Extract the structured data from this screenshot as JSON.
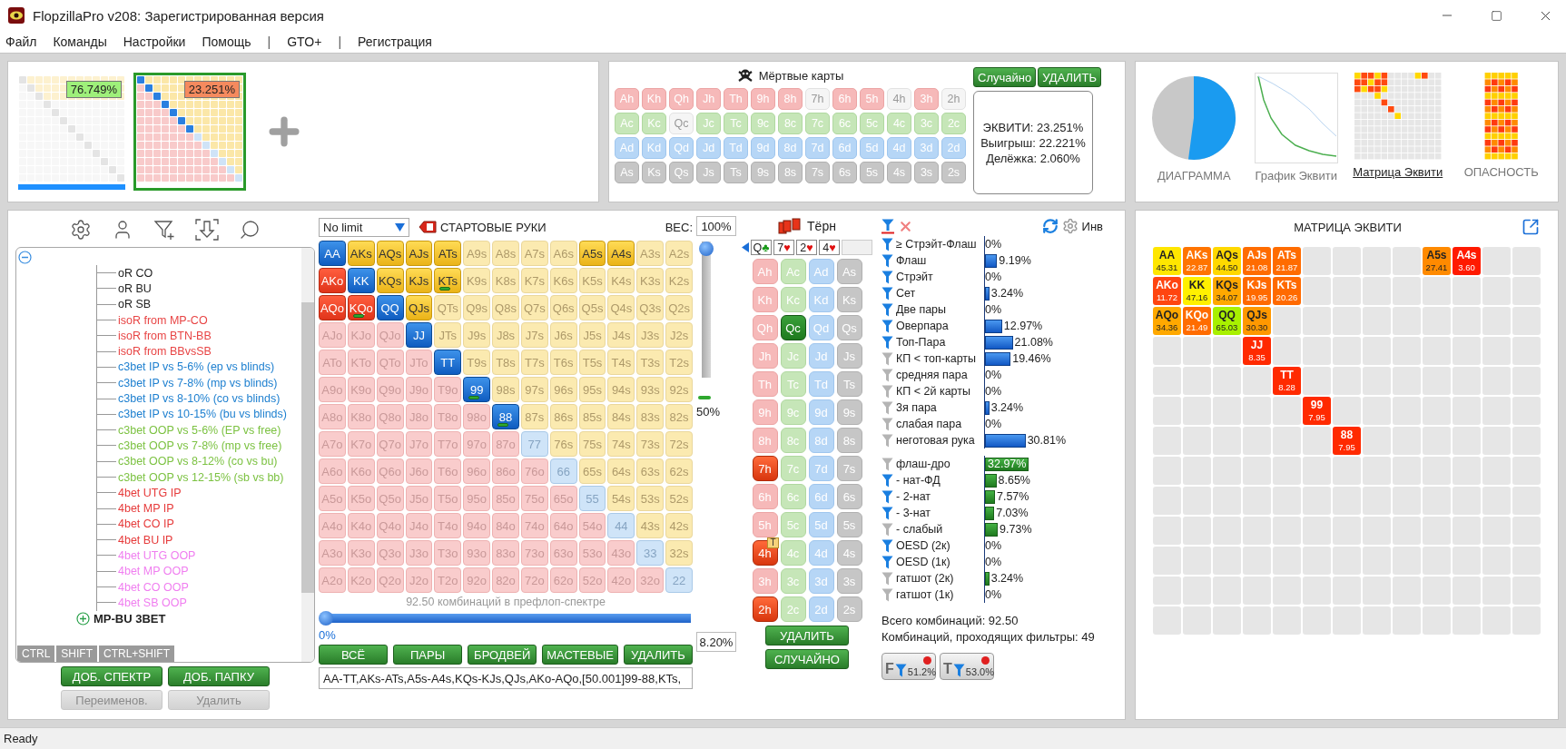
{
  "window": {
    "title": "FlopzillaPro v208: Зарегистрированная версия"
  },
  "menu": [
    {
      "label": "Файл",
      "kind": "item"
    },
    {
      "label": "Команды",
      "kind": "item"
    },
    {
      "label": "Настройки",
      "kind": "item"
    },
    {
      "label": "Помощь",
      "kind": "item"
    },
    {
      "label": "|",
      "kind": "separator"
    },
    {
      "label": "GTO+",
      "kind": "item"
    },
    {
      "label": "|",
      "kind": "separator"
    },
    {
      "label": "Регистрация",
      "kind": "item"
    }
  ],
  "ranges": [
    {
      "percent": "76.749%",
      "selected": false,
      "color": "#9ef07a"
    },
    {
      "percent": "23.251%",
      "selected": true,
      "color": "#f58a5e"
    }
  ],
  "dead_cards": {
    "title": "Мёртвые карты",
    "rows": [
      {
        "cards": [
          "Ah",
          "Kh",
          "Qh",
          "Jh",
          "Th",
          "9h",
          "8h",
          "7h",
          "6h",
          "5h",
          "4h",
          "3h",
          "2h"
        ],
        "disabled": [
          false,
          false,
          false,
          false,
          false,
          false,
          false,
          true,
          false,
          false,
          true,
          false,
          true
        ]
      },
      {
        "cards": [
          "Ac",
          "Kc",
          "Qc",
          "Jc",
          "Tc",
          "9c",
          "8c",
          "7c",
          "6c",
          "5c",
          "4c",
          "3c",
          "2c"
        ],
        "disabled": [
          false,
          false,
          true,
          false,
          false,
          false,
          false,
          false,
          false,
          false,
          false,
          false,
          false
        ]
      },
      {
        "cards": [
          "Ad",
          "Kd",
          "Qd",
          "Jd",
          "Td",
          "9d",
          "8d",
          "7d",
          "6d",
          "5d",
          "4d",
          "3d",
          "2d"
        ],
        "disabled": [
          false,
          false,
          false,
          false,
          false,
          false,
          false,
          false,
          false,
          false,
          false,
          false,
          false
        ]
      },
      {
        "cards": [
          "As",
          "Ks",
          "Qs",
          "Js",
          "Ts",
          "9s",
          "8s",
          "7s",
          "6s",
          "5s",
          "4s",
          "3s",
          "2s"
        ],
        "disabled": [
          false,
          false,
          false,
          false,
          false,
          false,
          false,
          false,
          false,
          false,
          false,
          false,
          false
        ]
      }
    ],
    "buttons": [
      "Случайно",
      "УДАЛИТЬ"
    ],
    "equity": [
      "ЭКВИТИ: 23.251%",
      "Выигрыш: 22.221%",
      "Делёжка: 2.060%"
    ]
  },
  "views": [
    {
      "label": "ДИАГРАММА",
      "selected": false
    },
    {
      "label": "График Эквити",
      "selected": false
    },
    {
      "label": "Матрица Эквити",
      "selected": true
    },
    {
      "label": "ОПАСНОСТЬ",
      "selected": false
    }
  ],
  "tree": {
    "nodes": [
      {
        "expanded": true,
        "children": [
          {
            "label": "oR CO",
            "color": "#222222"
          },
          {
            "label": "oR BU",
            "color": "#222222"
          },
          {
            "label": "oR SB",
            "color": "#222222"
          },
          {
            "label": "isoR from MP-CO",
            "color": "#e84545"
          },
          {
            "label": "isoR from BTN-BB",
            "color": "#e84545"
          },
          {
            "label": "isoR from BBvsSB",
            "color": "#e84545"
          },
          {
            "label": "c3bet IP vs 5-6% (ep vs blinds)",
            "color": "#1f80d0"
          },
          {
            "label": "c3bet IP vs 7-8% (mp vs blinds)",
            "color": "#1f80d0"
          },
          {
            "label": "c3bet IP vs 8-10% (co vs blinds)",
            "color": "#1f80d0"
          },
          {
            "label": "c3bet IP vs 10-15% (bu vs blinds)",
            "color": "#1f80d0"
          },
          {
            "label": "c3bet OOP vs 5-6% (EP vs free)",
            "color": "#7cc242"
          },
          {
            "label": "c3bet OOP vs 7-8% (mp vs free)",
            "color": "#7cc242"
          },
          {
            "label": "c3bet OOP vs 8-12% (co vs bu)",
            "color": "#7cc242"
          },
          {
            "label": "c3bet OOP vs 12-15% (sb vs bb)",
            "color": "#7cc242"
          },
          {
            "label": "4bet UTG IP",
            "color": "#e63a3a"
          },
          {
            "label": "4bet MP IP",
            "color": "#e63a3a"
          },
          {
            "label": "4bet CO IP",
            "color": "#e63a3a"
          },
          {
            "label": "4bet BU IP",
            "color": "#e63a3a"
          },
          {
            "label": "4bet UTG OOP",
            "color": "#f07ef0"
          },
          {
            "label": "4bet MP OOP",
            "color": "#f07ef0"
          },
          {
            "label": "4bet CO OOP",
            "color": "#f07ef0"
          },
          {
            "label": "4bet SB OOP",
            "color": "#f07ef0"
          }
        ]
      },
      {
        "label": "MP-BU 3BET",
        "expanded": false
      }
    ],
    "tabs": [
      "CTRL",
      "SHIFT",
      "CTRL+SHIFT"
    ],
    "buttons": [
      {
        "label": "ДОБ. СПЕКТР",
        "disabled": false
      },
      {
        "label": "ДОБ. ПАПКУ",
        "disabled": false
      },
      {
        "label": "Переименов.",
        "disabled": true
      },
      {
        "label": "Удалить",
        "disabled": true
      }
    ]
  },
  "hands": {
    "game": "No limit",
    "title": "СТАРТОВЫЕ РУКИ",
    "weight_label": "ВЕС:",
    "weight": "100%",
    "rows": [
      {
        "labels": [
          "AA",
          "AKs",
          "AQs",
          "AJs",
          "ATs",
          "A9s",
          "A8s",
          "A7s",
          "A6s",
          "A5s",
          "A4s",
          "A3s",
          "A2s"
        ],
        "selected": [
          true,
          true,
          true,
          true,
          true,
          false,
          false,
          false,
          false,
          true,
          true,
          false,
          false
        ],
        "marked": [
          false,
          false,
          false,
          false,
          false,
          false,
          false,
          false,
          false,
          false,
          false,
          false,
          false
        ]
      },
      {
        "labels": [
          "AKo",
          "KK",
          "KQs",
          "KJs",
          "KTs",
          "K9s",
          "K8s",
          "K7s",
          "K6s",
          "K5s",
          "K4s",
          "K3s",
          "K2s"
        ],
        "selected": [
          true,
          true,
          true,
          true,
          true,
          false,
          false,
          false,
          false,
          false,
          false,
          false,
          false
        ],
        "marked": [
          false,
          false,
          false,
          false,
          true,
          false,
          false,
          false,
          false,
          false,
          false,
          false,
          false
        ]
      },
      {
        "labels": [
          "AQo",
          "KQo",
          "QQ",
          "QJs",
          "QTs",
          "Q9s",
          "Q8s",
          "Q7s",
          "Q6s",
          "Q5s",
          "Q4s",
          "Q3s",
          "Q2s"
        ],
        "selected": [
          true,
          true,
          true,
          true,
          false,
          false,
          false,
          false,
          false,
          false,
          false,
          false,
          false
        ],
        "marked": [
          false,
          true,
          false,
          false,
          false,
          false,
          false,
          false,
          false,
          false,
          false,
          false,
          false
        ]
      },
      {
        "labels": [
          "AJo",
          "KJo",
          "QJo",
          "JJ",
          "JTs",
          "J9s",
          "J8s",
          "J7s",
          "J6s",
          "J5s",
          "J4s",
          "J3s",
          "J2s"
        ],
        "selected": [
          false,
          false,
          false,
          true,
          false,
          false,
          false,
          false,
          false,
          false,
          false,
          false,
          false
        ],
        "marked": [
          false,
          false,
          false,
          false,
          false,
          false,
          false,
          false,
          false,
          false,
          false,
          false,
          false
        ]
      },
      {
        "labels": [
          "ATo",
          "KTo",
          "QTo",
          "JTo",
          "TT",
          "T9s",
          "T8s",
          "T7s",
          "T6s",
          "T5s",
          "T4s",
          "T3s",
          "T2s"
        ],
        "selected": [
          false,
          false,
          false,
          false,
          true,
          false,
          false,
          false,
          false,
          false,
          false,
          false,
          false
        ],
        "marked": [
          false,
          false,
          false,
          false,
          false,
          false,
          false,
          false,
          false,
          false,
          false,
          false,
          false
        ]
      },
      {
        "labels": [
          "A9o",
          "K9o",
          "Q9o",
          "J9o",
          "T9o",
          "99",
          "98s",
          "97s",
          "96s",
          "95s",
          "94s",
          "93s",
          "92s"
        ],
        "selected": [
          false,
          false,
          false,
          false,
          false,
          true,
          false,
          false,
          false,
          false,
          false,
          false,
          false
        ],
        "marked": [
          false,
          false,
          false,
          false,
          false,
          true,
          false,
          false,
          false,
          false,
          false,
          false,
          false
        ]
      },
      {
        "labels": [
          "A8o",
          "K8o",
          "Q8o",
          "J8o",
          "T8o",
          "98o",
          "88",
          "87s",
          "86s",
          "85s",
          "84s",
          "83s",
          "82s"
        ],
        "selected": [
          false,
          false,
          false,
          false,
          false,
          false,
          true,
          false,
          false,
          false,
          false,
          false,
          false
        ],
        "marked": [
          false,
          false,
          false,
          false,
          false,
          false,
          true,
          false,
          false,
          false,
          false,
          false,
          false
        ]
      },
      {
        "labels": [
          "A7o",
          "K7o",
          "Q7o",
          "J7o",
          "T7o",
          "97o",
          "87o",
          "77",
          "76s",
          "75s",
          "74s",
          "73s",
          "72s"
        ],
        "selected": [
          false,
          false,
          false,
          false,
          false,
          false,
          false,
          false,
          false,
          false,
          false,
          false,
          false
        ],
        "marked": [
          false,
          false,
          false,
          false,
          false,
          false,
          false,
          false,
          false,
          false,
          false,
          false,
          false
        ]
      },
      {
        "labels": [
          "A6o",
          "K6o",
          "Q6o",
          "J6o",
          "T6o",
          "96o",
          "86o",
          "76o",
          "66",
          "65s",
          "64s",
          "63s",
          "62s"
        ],
        "selected": [
          false,
          false,
          false,
          false,
          false,
          false,
          false,
          false,
          false,
          false,
          false,
          false,
          false
        ],
        "marked": [
          false,
          false,
          false,
          false,
          false,
          false,
          false,
          false,
          false,
          false,
          false,
          false,
          false
        ]
      },
      {
        "labels": [
          "A5o",
          "K5o",
          "Q5o",
          "J5o",
          "T5o",
          "95o",
          "85o",
          "75o",
          "65o",
          "55",
          "54s",
          "53s",
          "52s"
        ],
        "selected": [
          false,
          false,
          false,
          false,
          false,
          false,
          false,
          false,
          false,
          false,
          false,
          false,
          false
        ],
        "marked": [
          false,
          false,
          false,
          false,
          false,
          false,
          false,
          false,
          false,
          false,
          false,
          false,
          false
        ]
      },
      {
        "labels": [
          "A4o",
          "K4o",
          "Q4o",
          "J4o",
          "T4o",
          "94o",
          "84o",
          "74o",
          "64o",
          "54o",
          "44",
          "43s",
          "42s"
        ],
        "selected": [
          false,
          false,
          false,
          false,
          false,
          false,
          false,
          false,
          false,
          false,
          false,
          false,
          false
        ],
        "marked": [
          false,
          false,
          false,
          false,
          false,
          false,
          false,
          false,
          false,
          false,
          false,
          false,
          false
        ]
      },
      {
        "labels": [
          "A3o",
          "K3o",
          "Q3o",
          "J3o",
          "T3o",
          "93o",
          "83o",
          "73o",
          "63o",
          "53o",
          "43o",
          "33",
          "32s"
        ],
        "selected": [
          false,
          false,
          false,
          false,
          false,
          false,
          false,
          false,
          false,
          false,
          false,
          false,
          false
        ],
        "marked": [
          false,
          false,
          false,
          false,
          false,
          false,
          false,
          false,
          false,
          false,
          false,
          false,
          false
        ]
      },
      {
        "labels": [
          "A2o",
          "K2o",
          "Q2o",
          "J2o",
          "T2o",
          "92o",
          "82o",
          "72o",
          "62o",
          "52o",
          "42o",
          "32o",
          "22"
        ],
        "selected": [
          false,
          false,
          false,
          false,
          false,
          false,
          false,
          false,
          false,
          false,
          false,
          false,
          false
        ],
        "marked": [
          false,
          false,
          false,
          false,
          false,
          false,
          false,
          false,
          false,
          false,
          false,
          false,
          false
        ]
      }
    ],
    "weight_slider": {
      "level": 1,
      "reading": "50%"
    },
    "percent_field": "8.20%",
    "combos_caption": "92.50 комбинаций в префлоп-спектре",
    "preflop_slider": {
      "level": 0,
      "reading": "0%"
    },
    "buttons": [
      "ВСЁ",
      "ПАРЫ",
      "БРОДВЕЙ",
      "МАСТЕВЫЕ",
      "УДАЛИТЬ"
    ],
    "range_text": "AA-TT,AKs-ATs,A5s-A4s,KQs-KJs,QJs,AKo-AQo,[50.001]99-88,KTs,"
  },
  "turn": {
    "title": "Тёрн",
    "board": [
      {
        "rank": "Q",
        "suit": "♣",
        "color": "#1a9a1a"
      },
      {
        "rank": "7",
        "suit": "♥",
        "color": "#e01010"
      },
      {
        "rank": "2",
        "suit": "♥",
        "color": "#e01010"
      },
      {
        "rank": "4",
        "suit": "♥",
        "color": "#e01010"
      }
    ],
    "rows": [
      [
        {
          "label": "Ah",
          "board": false,
          "selected": false
        },
        {
          "label": "Ac",
          "board": false,
          "selected": false
        },
        {
          "label": "Ad",
          "board": false,
          "selected": false
        },
        {
          "label": "As",
          "board": false,
          "selected": false
        }
      ],
      [
        {
          "label": "Kh",
          "board": false,
          "selected": false
        },
        {
          "label": "Kc",
          "board": false,
          "selected": false
        },
        {
          "label": "Kd",
          "board": false,
          "selected": false
        },
        {
          "label": "Ks",
          "board": false,
          "selected": false
        }
      ],
      [
        {
          "label": "Qh",
          "board": false,
          "selected": false
        },
        {
          "label": "Qc",
          "board": false,
          "selected": true
        },
        {
          "label": "Qd",
          "board": false,
          "selected": false
        },
        {
          "label": "Qs",
          "board": false,
          "selected": false
        }
      ],
      [
        {
          "label": "Jh",
          "board": false,
          "selected": false
        },
        {
          "label": "Jc",
          "board": false,
          "selected": false
        },
        {
          "label": "Jd",
          "board": false,
          "selected": false
        },
        {
          "label": "Js",
          "board": false,
          "selected": false
        }
      ],
      [
        {
          "label": "Th",
          "board": false,
          "selected": false
        },
        {
          "label": "Tc",
          "board": false,
          "selected": false
        },
        {
          "label": "Td",
          "board": false,
          "selected": false
        },
        {
          "label": "Ts",
          "board": false,
          "selected": false
        }
      ],
      [
        {
          "label": "9h",
          "board": false,
          "selected": false
        },
        {
          "label": "9c",
          "board": false,
          "selected": false
        },
        {
          "label": "9d",
          "board": false,
          "selected": false
        },
        {
          "label": "9s",
          "board": false,
          "selected": false
        }
      ],
      [
        {
          "label": "8h",
          "board": false,
          "selected": false
        },
        {
          "label": "8c",
          "board": false,
          "selected": false
        },
        {
          "label": "8d",
          "board": false,
          "selected": false
        },
        {
          "label": "8s",
          "board": false,
          "selected": false
        }
      ],
      [
        {
          "label": "7h",
          "board": true,
          "selected": false
        },
        {
          "label": "7c",
          "board": false,
          "selected": false
        },
        {
          "label": "7d",
          "board": false,
          "selected": false
        },
        {
          "label": "7s",
          "board": false,
          "selected": false
        }
      ],
      [
        {
          "label": "6h",
          "board": false,
          "selected": false
        },
        {
          "label": "6c",
          "board": false,
          "selected": false
        },
        {
          "label": "6d",
          "board": false,
          "selected": false
        },
        {
          "label": "6s",
          "board": false,
          "selected": false
        }
      ],
      [
        {
          "label": "5h",
          "board": false,
          "selected": false
        },
        {
          "label": "5c",
          "board": false,
          "selected": false
        },
        {
          "label": "5d",
          "board": false,
          "selected": false
        },
        {
          "label": "5s",
          "board": false,
          "selected": false
        }
      ],
      [
        {
          "label": "4h",
          "board": true,
          "selected": false,
          "badge": "T"
        },
        {
          "label": "4c",
          "board": false,
          "selected": false
        },
        {
          "label": "4d",
          "board": false,
          "selected": false
        },
        {
          "label": "4s",
          "board": false,
          "selected": false
        }
      ],
      [
        {
          "label": "3h",
          "board": false,
          "selected": false
        },
        {
          "label": "3c",
          "board": false,
          "selected": false
        },
        {
          "label": "3d",
          "board": false,
          "selected": false
        },
        {
          "label": "3s",
          "board": false,
          "selected": false
        }
      ],
      [
        {
          "label": "2h",
          "board": true,
          "selected": false
        },
        {
          "label": "2c",
          "board": false,
          "selected": false
        },
        {
          "label": "2d",
          "board": false,
          "selected": false
        },
        {
          "label": "2s",
          "board": false,
          "selected": false
        }
      ]
    ],
    "buttons": [
      "УДАЛИТЬ",
      "СЛУЧАЙНО"
    ]
  },
  "filters": {
    "invert_label": "Инв",
    "made": [
      {
        "label": "≥ Стрэйт-Флаш",
        "active": true,
        "level": 0,
        "value": "0%"
      },
      {
        "label": "Флаш",
        "active": true,
        "level": 0.0919,
        "value": "9.19%"
      },
      {
        "label": "Стрэйт",
        "active": true,
        "level": 0,
        "value": "0%"
      },
      {
        "label": "Сет",
        "active": true,
        "level": 0.0324,
        "value": "3.24%"
      },
      {
        "label": "Две пары",
        "active": true,
        "level": 0,
        "value": "0%"
      },
      {
        "label": "Оверпара",
        "active": true,
        "level": 0.1297,
        "value": "12.97%"
      },
      {
        "label": "Топ-Пара",
        "active": true,
        "level": 0.2108,
        "value": "21.08%"
      },
      {
        "label": "КП < топ-карты",
        "active": false,
        "level": 0.1946,
        "value": "19.46%"
      },
      {
        "label": "средняя пара",
        "active": false,
        "level": 0,
        "value": "0%"
      },
      {
        "label": "КП < 2й карты",
        "active": false,
        "level": 0,
        "value": "0%"
      },
      {
        "label": "3я пара",
        "active": false,
        "level": 0.0324,
        "value": "3.24%"
      },
      {
        "label": "слабая пара",
        "active": false,
        "level": 0,
        "value": "0%"
      },
      {
        "label": "неготовая рука",
        "active": false,
        "level": 0.3081,
        "value": "30.81%"
      }
    ],
    "draws": [
      {
        "label": "флаш-дро",
        "kind": "summary",
        "active": false,
        "level": 0.3297,
        "value": "32.97%"
      },
      {
        "label": "- нат-ФД",
        "kind": "line",
        "active": true,
        "level": 0.0865,
        "value": "8.65%"
      },
      {
        "label": "- 2-нат",
        "kind": "line",
        "active": true,
        "level": 0.0757,
        "value": "7.57%"
      },
      {
        "label": "- 3-нат",
        "kind": "line",
        "active": true,
        "level": 0.0703,
        "value": "7.03%"
      },
      {
        "label": "- слабый",
        "kind": "line",
        "active": false,
        "level": 0.0973,
        "value": "9.73%"
      },
      {
        "label": "OESD (2к)",
        "kind": "line",
        "active": true,
        "level": 0,
        "value": "0%"
      },
      {
        "label": "OESD (1к)",
        "kind": "line",
        "active": true,
        "level": 0,
        "value": "0%"
      },
      {
        "label": "гатшот (2к)",
        "kind": "line",
        "active": false,
        "level": 0.0324,
        "value": "3.24%"
      },
      {
        "label": "гатшот (1к)",
        "kind": "line",
        "active": false,
        "level": 0,
        "value": "0%"
      }
    ],
    "totals": [
      "Всего комбинаций: 92.50",
      "Комбинаций, проходящих фильтры: 49"
    ],
    "presets": [
      {
        "letter": "F",
        "value": "51.2%"
      },
      {
        "letter": "T",
        "value": "53.0%"
      }
    ]
  },
  "matrix": {
    "title": "МАТРИЦА ЭКВИТИ",
    "rows": [
      [
        {
          "label": "AA",
          "value": "45.31",
          "color": "#ffe600"
        },
        {
          "label": "AKs",
          "value": "22.87",
          "color": "#ff7400"
        },
        {
          "label": "AQs",
          "value": "44.50",
          "color": "#ffd800"
        },
        {
          "label": "AJs",
          "value": "21.08",
          "color": "#ff6c00"
        },
        {
          "label": "ATs",
          "value": "21.87",
          "color": "#ff6c00"
        },
        null,
        null,
        null,
        null,
        {
          "label": "A5s",
          "value": "27.41",
          "color": "#ff8a00"
        },
        {
          "label": "A4s",
          "value": "3.60",
          "color": "#ff1a00"
        },
        null,
        null
      ],
      [
        {
          "label": "AKo",
          "value": "11.72",
          "color": "#ff4510"
        },
        {
          "label": "KK",
          "value": "47.16",
          "color": "#fff000"
        },
        {
          "label": "KQs",
          "value": "34.07",
          "color": "#ffa800"
        },
        {
          "label": "KJs",
          "value": "19.95",
          "color": "#ff6a00"
        },
        {
          "label": "KTs",
          "value": "20.26",
          "color": "#ff6a00"
        },
        null,
        null,
        null,
        null,
        null,
        null,
        null,
        null
      ],
      [
        {
          "label": "AQo",
          "value": "34.36",
          "color": "#ffa800"
        },
        {
          "label": "KQo",
          "value": "21.49",
          "color": "#ff6c00"
        },
        {
          "label": "QQ",
          "value": "65.03",
          "color": "#a8f000"
        },
        {
          "label": "QJs",
          "value": "30.30",
          "color": "#ff9800"
        },
        null,
        null,
        null,
        null,
        null,
        null,
        null,
        null,
        null
      ],
      [
        null,
        null,
        null,
        {
          "label": "JJ",
          "value": "8.35",
          "color": "#ff2a00"
        },
        null,
        null,
        null,
        null,
        null,
        null,
        null,
        null,
        null
      ],
      [
        null,
        null,
        null,
        null,
        {
          "label": "TT",
          "value": "8.28",
          "color": "#ff2a00"
        },
        null,
        null,
        null,
        null,
        null,
        null,
        null,
        null
      ],
      [
        null,
        null,
        null,
        null,
        null,
        {
          "label": "99",
          "value": "7.95",
          "color": "#ff2a00"
        },
        null,
        null,
        null,
        null,
        null,
        null,
        null
      ],
      [
        null,
        null,
        null,
        null,
        null,
        null,
        {
          "label": "88",
          "value": "7.95",
          "color": "#ff2a00"
        },
        null,
        null,
        null,
        null,
        null,
        null
      ],
      [
        null,
        null,
        null,
        null,
        null,
        null,
        null,
        null,
        null,
        null,
        null,
        null,
        null
      ],
      [
        null,
        null,
        null,
        null,
        null,
        null,
        null,
        null,
        null,
        null,
        null,
        null,
        null
      ],
      [
        null,
        null,
        null,
        null,
        null,
        null,
        null,
        null,
        null,
        null,
        null,
        null,
        null
      ],
      [
        null,
        null,
        null,
        null,
        null,
        null,
        null,
        null,
        null,
        null,
        null,
        null,
        null
      ],
      [
        null,
        null,
        null,
        null,
        null,
        null,
        null,
        null,
        null,
        null,
        null,
        null,
        null
      ],
      [
        null,
        null,
        null,
        null,
        null,
        null,
        null,
        null,
        null,
        null,
        null,
        null,
        null
      ]
    ]
  },
  "status_bar": "Ready"
}
